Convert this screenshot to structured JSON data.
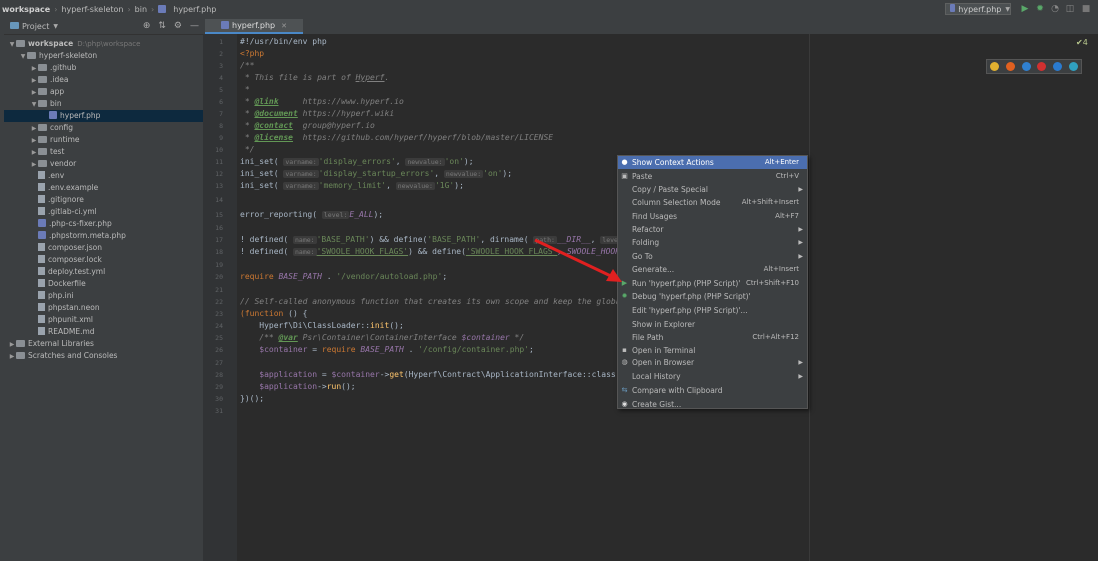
{
  "breadcrumbs": [
    "workspace",
    "hyperf-skeleton",
    "bin",
    "hyperf.php"
  ],
  "run_config": "hyperf.php",
  "colors": {
    "accent": "#4b6eaf",
    "background": "#2b2b2b",
    "panel": "#3c3f41",
    "arrow": "#e02020"
  },
  "project_panel": {
    "title": "Project",
    "tree": [
      {
        "label": "workspace",
        "hint": "D:\\php\\workspace",
        "level": 0,
        "type": "folder",
        "open": true
      },
      {
        "label": "hyperf-skeleton",
        "level": 1,
        "type": "folder",
        "open": true
      },
      {
        "label": ".github",
        "level": 2,
        "type": "folder",
        "open": false
      },
      {
        "label": ".idea",
        "level": 2,
        "type": "folder",
        "open": false
      },
      {
        "label": "app",
        "level": 2,
        "type": "folder",
        "open": false
      },
      {
        "label": "bin",
        "level": 2,
        "type": "folder",
        "open": true
      },
      {
        "label": "hyperf.php",
        "level": 3,
        "type": "php",
        "selected": true
      },
      {
        "label": "config",
        "level": 2,
        "type": "folder",
        "open": false
      },
      {
        "label": "runtime",
        "level": 2,
        "type": "folder",
        "open": false
      },
      {
        "label": "test",
        "level": 2,
        "type": "folder",
        "open": false
      },
      {
        "label": "vendor",
        "level": 2,
        "type": "folder",
        "open": false
      },
      {
        "label": ".env",
        "level": 2,
        "type": "file"
      },
      {
        "label": ".env.example",
        "level": 2,
        "type": "file"
      },
      {
        "label": ".gitignore",
        "level": 2,
        "type": "file"
      },
      {
        "label": ".gitlab-ci.yml",
        "level": 2,
        "type": "file"
      },
      {
        "label": ".php-cs-fixer.php",
        "level": 2,
        "type": "php"
      },
      {
        "label": ".phpstorm.meta.php",
        "level": 2,
        "type": "php"
      },
      {
        "label": "composer.json",
        "level": 2,
        "type": "file"
      },
      {
        "label": "composer.lock",
        "level": 2,
        "type": "file"
      },
      {
        "label": "deploy.test.yml",
        "level": 2,
        "type": "file"
      },
      {
        "label": "Dockerfile",
        "level": 2,
        "type": "file"
      },
      {
        "label": "php.ini",
        "level": 2,
        "type": "file"
      },
      {
        "label": "phpstan.neon",
        "level": 2,
        "type": "file"
      },
      {
        "label": "phpunit.xml",
        "level": 2,
        "type": "file"
      },
      {
        "label": "README.md",
        "level": 2,
        "type": "file"
      },
      {
        "label": "External Libraries",
        "level": 0,
        "type": "folder",
        "open": false
      },
      {
        "label": "Scratches and Consoles",
        "level": 0,
        "type": "folder",
        "open": false
      }
    ]
  },
  "editor": {
    "tab_label": "hyperf.php",
    "inspection_count": "4",
    "line_numbers": [
      "1",
      "2",
      "3",
      "4",
      "5",
      "6",
      "7",
      "8",
      "9",
      "10",
      "11",
      "12",
      "13",
      "14",
      "15",
      "16",
      "17",
      "18",
      "19",
      "20",
      "21",
      "22",
      "23",
      "24",
      "25",
      "26",
      "27",
      "28",
      "29",
      "30",
      "31"
    ],
    "lines": {
      "l1": "#!/usr/bin/env php",
      "l2": "<?php",
      "l3": "/**",
      "l4a": " * This file is part of ",
      "l4b": "Hyperf",
      "l4c": ".",
      "l5": " *",
      "l6a": " * ",
      "l6b": "@link",
      "l6c": "     https://www.hyperf.io",
      "l7a": " * ",
      "l7b": "@document",
      "l7c": " https://hyperf.wiki",
      "l8a": " * ",
      "l8b": "@contact",
      "l8c": "  group@hyperf.io",
      "l9a": " * ",
      "l9b": "@license",
      "l9c": "  https://github.com/hyperf/hyperf/blob/master/LICENSE",
      "l10": " */",
      "l11a": "ini_set(",
      "l11h1": "varname:",
      "l11s1": "'display_errors'",
      "l11h2": "newvalue:",
      "l11s2": "'on'",
      "l11e": ");",
      "l12a": "ini_set(",
      "l12h1": "varname:",
      "l12s1": "'display_startup_errors'",
      "l12h2": "newvalue:",
      "l12s2": "'on'",
      "l12e": ");",
      "l13a": "ini_set(",
      "l13h1": "varname:",
      "l13s1": "'memory_limit'",
      "l13h2": "newvalue:",
      "l13s2": "'1G'",
      "l13e": ");",
      "l15a": "error_reporting(",
      "l15h": "level:",
      "l15c": "E_ALL",
      "l15e": ");",
      "l17a": "! defined(",
      "l17h1": "name:",
      "l17s1": "'BASE_PATH'",
      "l17b": ") && define(",
      "l17s2": "'BASE_PATH'",
      "l17c": ", dirname(",
      "l17h2": "path:",
      "l17d": "__DIR__",
      "l17e": ",",
      "l17h3": "levels:",
      "l18a": "! defined(",
      "l18h1": "name:",
      "l18s1": "'SWOOLE_HOOK_FLAGS'",
      "l18b": ") && define(",
      "l18s2": "'SWOOLE_HOOK_FLAGS'",
      "l18c": ", SWOOLE_HOOK_",
      "l20a": "require ",
      "l20b": "BASE_PATH",
      "l20c": " . ",
      "l20d": "'/vendor/autoload.php'",
      "l20e": ";",
      "l22": "// Self-called anonymous function that creates its own scope and keep the global",
      "l23a": "(function",
      "l23b": " () {",
      "l24a": "    Hyperf\\Di\\ClassLoader::",
      "l24b": "init",
      "l24c": "();",
      "l25a": "    /** ",
      "l25b": "@var",
      "l25c": " Psr\\Container\\ContainerInterface ",
      "l25d": "$container",
      "l25e": " */",
      "l26a": "    ",
      "l26b": "$container",
      "l26c": " = ",
      "l26d": "require ",
      "l26e": "BASE_PATH",
      "l26f": " . ",
      "l26g": "'/config/container.php'",
      "l26h": ";",
      "l28a": "    ",
      "l28b": "$application",
      "l28c": " = ",
      "l28d": "$container",
      "l28e": "->",
      "l28f": "get",
      "l28g": "(Hyperf\\Contract\\ApplicationInterface::class);",
      "l29a": "    ",
      "l29b": "$application",
      "l29c": "->",
      "l29d": "run",
      "l29e": "();",
      "l30": "})();"
    }
  },
  "context_menu": {
    "items": [
      {
        "label": "Show Context Actions",
        "shortcut": "Alt+Enter",
        "selected": true,
        "icon": "bulb"
      },
      {
        "label": "Paste",
        "shortcut": "Ctrl+V",
        "icon": "clipboard"
      },
      {
        "label": "Copy / Paste Special",
        "submenu": true
      },
      {
        "label": "Column Selection Mode",
        "shortcut": "Alt+Shift+Insert"
      },
      {
        "label": "Find Usages",
        "shortcut": "Alt+F7"
      },
      {
        "label": "Refactor",
        "submenu": true
      },
      {
        "label": "Folding",
        "submenu": true
      },
      {
        "label": "Go To",
        "submenu": true
      },
      {
        "label": "Generate...",
        "shortcut": "Alt+Insert"
      },
      {
        "label": "Run 'hyperf.php (PHP Script)'",
        "shortcut": "Ctrl+Shift+F10",
        "icon": "run"
      },
      {
        "label": "Debug 'hyperf.php (PHP Script)'",
        "icon": "debug"
      },
      {
        "label": "Edit 'hyperf.php (PHP Script)'..."
      },
      {
        "label": "Show in Explorer"
      },
      {
        "label": "File Path",
        "shortcut": "Ctrl+Alt+F12"
      },
      {
        "label": "Open in Terminal",
        "icon": "terminal"
      },
      {
        "label": "Open in Browser",
        "submenu": true,
        "icon": "globe"
      },
      {
        "label": "Local History",
        "submenu": true
      },
      {
        "label": "Compare with Clipboard",
        "icon": "compare"
      },
      {
        "label": "Create Gist...",
        "icon": "github"
      }
    ]
  }
}
